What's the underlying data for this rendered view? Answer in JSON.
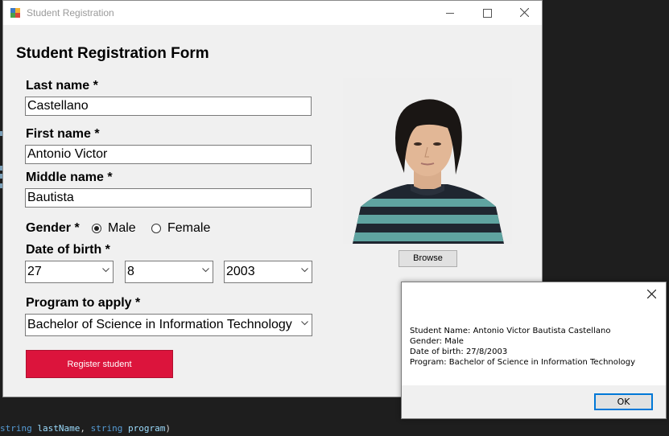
{
  "window": {
    "title": "Student Registration"
  },
  "form": {
    "title": "Student Registration Form",
    "last_name": {
      "label": "Last name *",
      "value": "Castellano"
    },
    "first_name": {
      "label": "First name *",
      "value": "Antonio Victor"
    },
    "middle_name": {
      "label": "Middle name *",
      "value": "Bautista"
    },
    "gender": {
      "label": "Gender *",
      "options": [
        {
          "label": "Male",
          "selected": true
        },
        {
          "label": "Female",
          "selected": false
        }
      ]
    },
    "dob": {
      "label": "Date of birth *",
      "day": "27",
      "month": "8",
      "year": "2003"
    },
    "program": {
      "label": "Program to apply *",
      "value": "Bachelor of Science in Information Technology"
    },
    "browse_label": "Browse",
    "register_label": "Register student"
  },
  "message_box": {
    "lines": [
      "Student Name: Antonio Victor Bautista Castellano",
      "Gender: Male",
      "Date of birth: 27/8/2003",
      "Program: Bachelor of Science in Information Technology"
    ],
    "ok_label": "OK"
  },
  "code_editor": {
    "kw1": "string",
    "id1": "lastName",
    "kw2": "string",
    "id2": "program",
    "punct_comma": ", ",
    "punct_close": ")"
  },
  "colors": {
    "accent_register": "#dc143c",
    "ok_focus": "#0078d7"
  }
}
